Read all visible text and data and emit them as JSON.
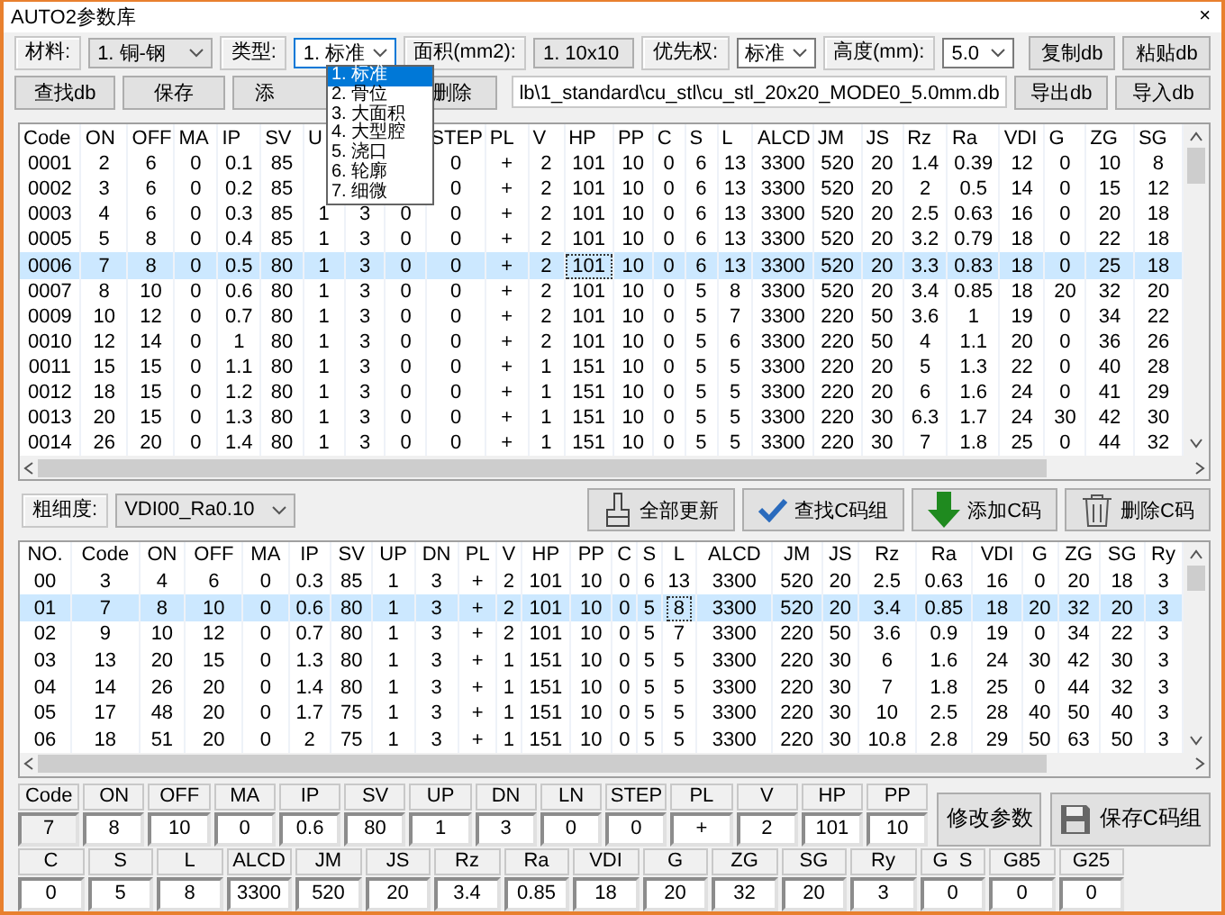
{
  "window": {
    "title": "AUTO2参数库",
    "close": "×"
  },
  "filters": [
    {
      "label": "材料:",
      "value": "1. 铜-钢",
      "focused": false
    },
    {
      "label": "类型:",
      "value": "1. 标准",
      "focused": true
    },
    {
      "label": "面积(mm2):",
      "value": "1. 10x10",
      "focused": false
    },
    {
      "label": "优先权:",
      "value": "标准",
      "focused": false
    },
    {
      "label": "高度(mm):",
      "value": "5.0",
      "focused": false
    }
  ],
  "top_buttons": [
    "复制db",
    "粘贴db"
  ],
  "left_buttons": [
    "查找db",
    "保存",
    "添",
    "删除"
  ],
  "db_path": "lb\\1_standard\\cu_stl\\cu_stl_20x20_MODE0_5.0mm.db",
  "right_buttons": [
    "导出db",
    "导入db"
  ],
  "type_dropdown": {
    "items": [
      {
        "label": "1. 标准",
        "selected": true
      },
      {
        "label": "2. 骨位",
        "selected": false
      },
      {
        "label": "3. 大面积",
        "selected": false
      },
      {
        "label": "4. 大型腔",
        "selected": false
      },
      {
        "label": "5. 浇口",
        "selected": false
      },
      {
        "label": "6. 轮廓",
        "selected": false
      },
      {
        "label": "7. 细微",
        "selected": false
      }
    ]
  },
  "code_table": {
    "columns": [
      "Code",
      "ON",
      "OFF",
      "MA",
      "IP",
      "SV",
      "U",
      null,
      null,
      "STEP",
      "PL",
      "V",
      "HP",
      "PP",
      "C",
      "S",
      "L",
      "ALCD",
      "JM",
      "JS",
      "Rz",
      "Ra",
      "VDI",
      "G",
      "ZG",
      "SG"
    ],
    "rows": [
      {
        "selected": false,
        "cells": [
          "0001",
          "2",
          "6",
          "0",
          "0.1",
          "85",
          null,
          null,
          null,
          "0",
          "+",
          "2",
          "101",
          "10",
          "0",
          "6",
          "13",
          "3300",
          "520",
          "20",
          "1.4",
          "0.39",
          "12",
          "0",
          "10",
          "8"
        ]
      },
      {
        "selected": false,
        "cells": [
          "0002",
          "3",
          "6",
          "0",
          "0.2",
          "85",
          null,
          null,
          null,
          "0",
          "+",
          "2",
          "101",
          "10",
          "0",
          "6",
          "13",
          "3300",
          "520",
          "20",
          "2",
          "0.5",
          "14",
          "0",
          "15",
          "12"
        ]
      },
      {
        "selected": false,
        "cells": [
          "0003",
          "4",
          "6",
          "0",
          "0.3",
          "85",
          "1",
          "3",
          "0",
          "0",
          "+",
          "2",
          "101",
          "10",
          "0",
          "6",
          "13",
          "3300",
          "520",
          "20",
          "2.5",
          "0.63",
          "16",
          "0",
          "20",
          "18"
        ]
      },
      {
        "selected": false,
        "cells": [
          "0005",
          "5",
          "8",
          "0",
          "0.4",
          "85",
          "1",
          "3",
          "0",
          "0",
          "+",
          "2",
          "101",
          "10",
          "0",
          "6",
          "13",
          "3300",
          "520",
          "20",
          "3.2",
          "0.79",
          "18",
          "0",
          "22",
          "18"
        ]
      },
      {
        "selected": true,
        "cells": [
          "0006",
          "7",
          "8",
          "0",
          "0.5",
          "80",
          "1",
          "3",
          "0",
          "0",
          "+",
          "2",
          {
            "text": "101",
            "focused": true
          },
          "10",
          "0",
          "6",
          "13",
          "3300",
          "520",
          "20",
          "3.3",
          "0.83",
          "18",
          "0",
          "25",
          "18"
        ]
      },
      {
        "selected": false,
        "cells": [
          "0007",
          "8",
          "10",
          "0",
          "0.6",
          "80",
          "1",
          "3",
          "0",
          "0",
          "+",
          "2",
          "101",
          "10",
          "0",
          "5",
          "8",
          "3300",
          "520",
          "20",
          "3.4",
          "0.85",
          "18",
          "20",
          "32",
          "20"
        ]
      },
      {
        "selected": false,
        "cells": [
          "0009",
          "10",
          "12",
          "0",
          "0.7",
          "80",
          "1",
          "3",
          "0",
          "0",
          "+",
          "2",
          "101",
          "10",
          "0",
          "5",
          "7",
          "3300",
          "220",
          "50",
          "3.6",
          "1",
          "19",
          "0",
          "34",
          "22"
        ]
      },
      {
        "selected": false,
        "cells": [
          "0010",
          "12",
          "14",
          "0",
          "1",
          "80",
          "1",
          "3",
          "0",
          "0",
          "+",
          "2",
          "101",
          "10",
          "0",
          "5",
          "6",
          "3300",
          "220",
          "50",
          "4",
          "1.1",
          "20",
          "0",
          "36",
          "26"
        ]
      },
      {
        "selected": false,
        "cells": [
          "0011",
          "15",
          "15",
          "0",
          "1.1",
          "80",
          "1",
          "3",
          "0",
          "0",
          "+",
          "1",
          "151",
          "10",
          "0",
          "5",
          "5",
          "3300",
          "220",
          "20",
          "5",
          "1.3",
          "22",
          "0",
          "40",
          "28"
        ]
      },
      {
        "selected": false,
        "cells": [
          "0012",
          "18",
          "15",
          "0",
          "1.2",
          "80",
          "1",
          "3",
          "0",
          "0",
          "+",
          "1",
          "151",
          "10",
          "0",
          "5",
          "5",
          "3300",
          "220",
          "20",
          "6",
          "1.6",
          "24",
          "0",
          "41",
          "29"
        ]
      },
      {
        "selected": false,
        "cells": [
          "0013",
          "20",
          "15",
          "0",
          "1.3",
          "80",
          "1",
          "3",
          "0",
          "0",
          "+",
          "1",
          "151",
          "10",
          "0",
          "5",
          "5",
          "3300",
          "220",
          "30",
          "6.3",
          "1.7",
          "24",
          "30",
          "42",
          "30"
        ]
      },
      {
        "selected": false,
        "cells": [
          "0014",
          "26",
          "20",
          "0",
          "1.4",
          "80",
          "1",
          "3",
          "0",
          "0",
          "+",
          "1",
          "151",
          "10",
          "0",
          "5",
          "5",
          "3300",
          "220",
          "30",
          "7",
          "1.8",
          "25",
          "0",
          "44",
          "32"
        ]
      }
    ]
  },
  "roughness": {
    "label": "粗细度:",
    "value": "VDI00_Ra0.10"
  },
  "group_buttons": [
    {
      "kind": "brush",
      "label": "全部更新"
    },
    {
      "kind": "check",
      "label": "查找C码组"
    },
    {
      "kind": "add",
      "label": "添加C码"
    },
    {
      "kind": "trash",
      "label": "删除C码"
    }
  ],
  "group_table": {
    "columns": [
      "NO.",
      "Code",
      "ON",
      "OFF",
      "MA",
      "IP",
      "SV",
      "UP",
      "DN",
      "PL",
      "V",
      "HP",
      "PP",
      "C",
      "S",
      "L",
      "ALCD",
      "JM",
      "JS",
      "Rz",
      "Ra",
      "VDI",
      "G",
      "ZG",
      "SG",
      "Ry"
    ],
    "rows": [
      {
        "selected": false,
        "cells": [
          "00",
          "3",
          "4",
          "6",
          "0",
          "0.3",
          "85",
          "1",
          "3",
          "+",
          "2",
          "101",
          "10",
          "0",
          "6",
          "13",
          "3300",
          "520",
          "20",
          "2.5",
          "0.63",
          "16",
          "0",
          "20",
          "18",
          "3"
        ]
      },
      {
        "selected": true,
        "cells": [
          "01",
          "7",
          "8",
          "10",
          "0",
          "0.6",
          "80",
          "1",
          "3",
          "+",
          "2",
          "101",
          "10",
          "0",
          "5",
          {
            "text": "8",
            "focused": true
          },
          "3300",
          "520",
          "20",
          "3.4",
          "0.85",
          "18",
          "20",
          "32",
          "20",
          "3"
        ]
      },
      {
        "selected": false,
        "cells": [
          "02",
          "9",
          "10",
          "12",
          "0",
          "0.7",
          "80",
          "1",
          "3",
          "+",
          "2",
          "101",
          "10",
          "0",
          "5",
          "7",
          "3300",
          "220",
          "50",
          "3.6",
          "0.9",
          "19",
          "0",
          "34",
          "22",
          "3"
        ]
      },
      {
        "selected": false,
        "cells": [
          "03",
          "13",
          "20",
          "15",
          "0",
          "1.3",
          "80",
          "1",
          "3",
          "+",
          "1",
          "151",
          "10",
          "0",
          "5",
          "5",
          "3300",
          "220",
          "30",
          "6",
          "1.6",
          "24",
          "30",
          "42",
          "30",
          "3"
        ]
      },
      {
        "selected": false,
        "cells": [
          "04",
          "14",
          "26",
          "20",
          "0",
          "1.4",
          "80",
          "1",
          "3",
          "+",
          "1",
          "151",
          "10",
          "0",
          "5",
          "5",
          "3300",
          "220",
          "30",
          "7",
          "1.8",
          "25",
          "0",
          "44",
          "32",
          "3"
        ]
      },
      {
        "selected": false,
        "cells": [
          "05",
          "17",
          "48",
          "20",
          "0",
          "1.7",
          "75",
          "1",
          "3",
          "+",
          "1",
          "151",
          "10",
          "0",
          "5",
          "5",
          "3300",
          "220",
          "30",
          "10",
          "2.5",
          "28",
          "40",
          "50",
          "40",
          "3"
        ]
      },
      {
        "selected": false,
        "cells": [
          "06",
          "18",
          "51",
          "20",
          "0",
          "2",
          "75",
          "1",
          "3",
          "+",
          "1",
          "151",
          "10",
          "0",
          "5",
          "5",
          "3300",
          "220",
          "30",
          "10.8",
          "2.8",
          "29",
          "50",
          "63",
          "50",
          "3"
        ]
      }
    ]
  },
  "edit_fields": [
    [
      {
        "label": "Code",
        "value": "7",
        "readonly": true
      },
      {
        "label": "ON",
        "value": "8",
        "readonly": false
      },
      {
        "label": "OFF",
        "value": "10",
        "readonly": false
      },
      {
        "label": "MA",
        "value": "0",
        "readonly": false
      },
      {
        "label": "IP",
        "value": "0.6",
        "readonly": false
      },
      {
        "label": "SV",
        "value": "80",
        "readonly": false
      },
      {
        "label": "UP",
        "value": "1",
        "readonly": false
      },
      {
        "label": "DN",
        "value": "3",
        "readonly": false
      },
      {
        "label": "LN",
        "value": "0",
        "readonly": false
      },
      {
        "label": "STEP",
        "value": "0",
        "readonly": false
      },
      {
        "label": "PL",
        "value": "+",
        "readonly": false
      },
      {
        "label": "V",
        "value": "2",
        "readonly": false
      },
      {
        "label": "HP",
        "value": "101",
        "readonly": false
      },
      {
        "label": "PP",
        "value": "10",
        "readonly": false
      }
    ],
    [
      {
        "label": "C",
        "value": "0",
        "readonly": false
      },
      {
        "label": "S",
        "value": "5",
        "readonly": false
      },
      {
        "label": "L",
        "value": "8",
        "readonly": false
      },
      {
        "label": "ALCD",
        "value": "3300",
        "readonly": false
      },
      {
        "label": "JM",
        "value": "520",
        "readonly": false
      },
      {
        "label": "JS",
        "value": "20",
        "readonly": false
      },
      {
        "label": "Rz",
        "value": "3.4",
        "readonly": false
      },
      {
        "label": "Ra",
        "value": "0.85",
        "readonly": false
      },
      {
        "label": "VDI",
        "value": "18",
        "readonly": false
      },
      {
        "label": "G",
        "value": "20",
        "readonly": false
      },
      {
        "label": "ZG",
        "value": "32",
        "readonly": false
      },
      {
        "label": "SG",
        "value": "20",
        "readonly": false
      },
      {
        "label": "Ry",
        "value": "3",
        "readonly": false
      },
      {
        "label": "G  S",
        "value": "0",
        "readonly": false
      },
      {
        "label": "G85",
        "value": "0",
        "readonly": false
      },
      {
        "label": "G25",
        "value": "0",
        "readonly": false
      }
    ]
  ],
  "edit_buttons": [
    {
      "kind": "plain",
      "label": "修改参数"
    },
    {
      "kind": "save",
      "label": "保存C码组"
    }
  ]
}
